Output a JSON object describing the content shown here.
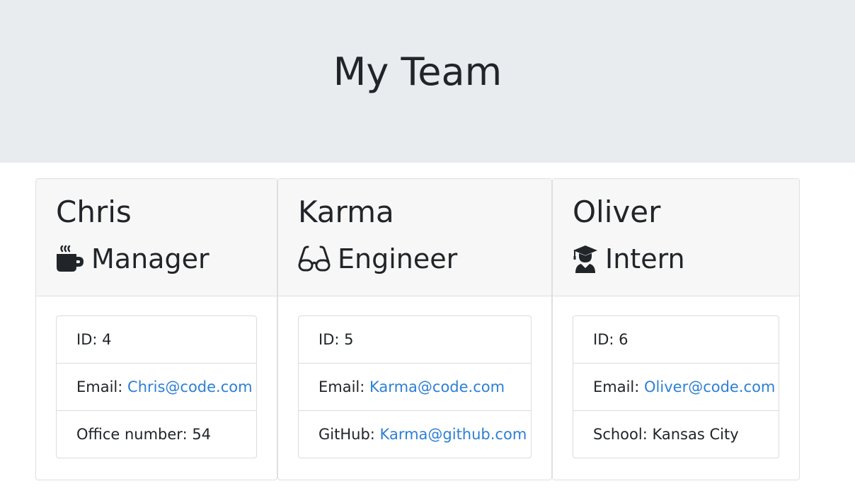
{
  "header": {
    "title": "My Team"
  },
  "cards": [
    {
      "name": "Chris",
      "role": "Manager",
      "role_icon": "coffee-mug-icon",
      "id_label": "ID: 4",
      "email_label": "Email: ",
      "email": "Chris@code.com",
      "extra_label": "Office number: 54",
      "extra_link": ""
    },
    {
      "name": "Karma",
      "role": "Engineer",
      "role_icon": "glasses-icon",
      "id_label": "ID: 5",
      "email_label": "Email: ",
      "email": "Karma@code.com",
      "extra_label": "GitHub: ",
      "extra_link": "Karma@github.com"
    },
    {
      "name": "Oliver",
      "role": "Intern",
      "role_icon": "graduate-icon",
      "id_label": "ID: 6",
      "email_label": "Email: ",
      "email": "Oliver@code.com",
      "extra_label": "School: Kansas City",
      "extra_link": ""
    }
  ],
  "colors": {
    "jumbotron_bg": "#e9ecef",
    "card_header_bg": "#f7f7f7",
    "link": "#2d7fd6",
    "text": "#212529"
  }
}
